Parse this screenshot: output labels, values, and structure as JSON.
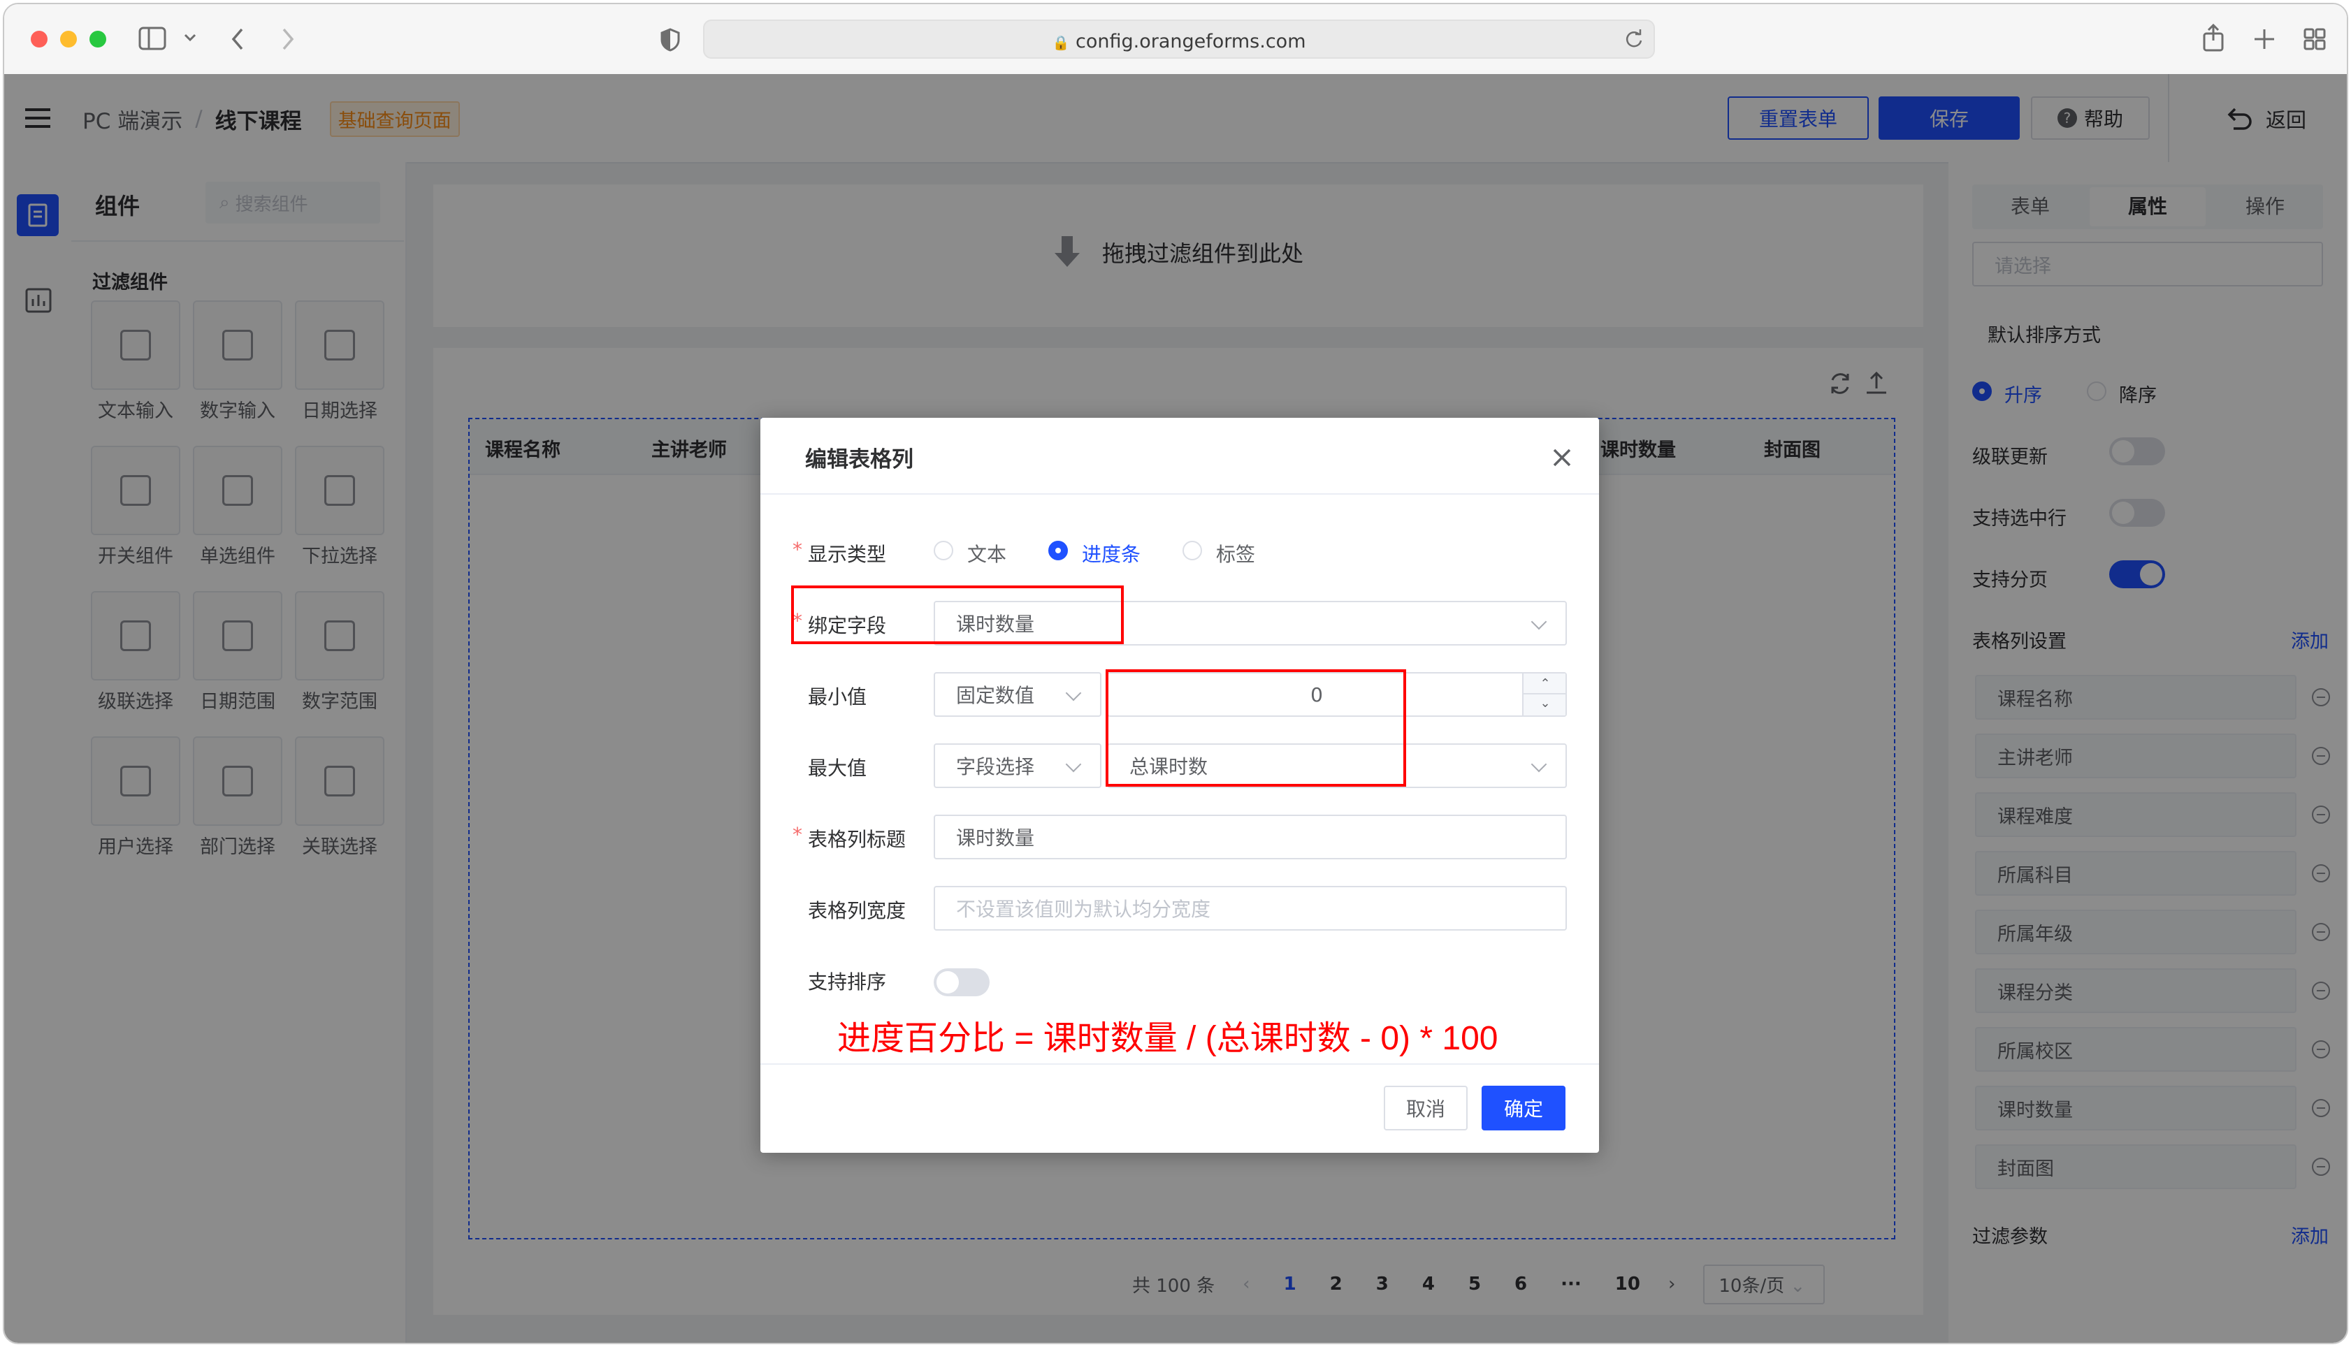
{
  "browser": {
    "url": "config.orangeforms.com"
  },
  "header": {
    "breadcrumb_root": "PC 端演示",
    "breadcrumb_sep": "/",
    "breadcrumb_current": "线下课程",
    "page_tag": "基础查询页面",
    "reset_label": "重置表单",
    "save_label": "保存",
    "help_label": "帮助",
    "back_label": "返回"
  },
  "left_panel": {
    "title": "组件",
    "search_placeholder": "搜索组件",
    "section_title": "过滤组件",
    "components": [
      {
        "label": "文本输入",
        "icon": "text-input-icon"
      },
      {
        "label": "数字输入",
        "icon": "number-input-icon"
      },
      {
        "label": "日期选择",
        "icon": "date-picker-icon"
      },
      {
        "label": "开关组件",
        "icon": "switch-icon"
      },
      {
        "label": "单选组件",
        "icon": "radio-icon"
      },
      {
        "label": "下拉选择",
        "icon": "dropdown-icon"
      },
      {
        "label": "级联选择",
        "icon": "cascader-icon"
      },
      {
        "label": "日期范围",
        "icon": "date-range-icon"
      },
      {
        "label": "数字范围",
        "icon": "number-range-icon"
      },
      {
        "label": "用户选择",
        "icon": "user-select-icon"
      },
      {
        "label": "部门选择",
        "icon": "dept-select-icon"
      },
      {
        "label": "关联选择",
        "icon": "relation-select-icon"
      }
    ]
  },
  "canvas": {
    "drop_hint": "拖拽过滤组件到此处",
    "table_headers": [
      "课程名称",
      "主讲老师",
      "课时数量",
      "封面图"
    ],
    "pagination": {
      "total": "共 100 条",
      "pages": [
        "1",
        "2",
        "3",
        "4",
        "5",
        "6",
        "···",
        "10"
      ],
      "current": "1",
      "page_size": "10条/页"
    }
  },
  "right_panel": {
    "tabs": [
      "表单",
      "属性",
      "操作"
    ],
    "active_tab": "属性",
    "select_placeholder": "请选择",
    "sort_label": "默认排序方式",
    "sort_asc": "升序",
    "sort_desc": "降序",
    "cascade_update": "级联更新",
    "support_select_row": "支持选中行",
    "support_paging": "支持分页",
    "column_settings": "表格列设置",
    "add_label": "添加",
    "columns": [
      "课程名称",
      "主讲老师",
      "课程难度",
      "所属科目",
      "所属年级",
      "课程分类",
      "所属校区",
      "课时数量",
      "封面图"
    ],
    "filter_params": "过滤参数",
    "add_label2": "添加"
  },
  "dialog": {
    "title": "编辑表格列",
    "display_type_label": "显示类型",
    "display_types": [
      "文本",
      "进度条",
      "标签"
    ],
    "display_type_selected": "进度条",
    "bind_field_label": "绑定字段",
    "bind_field_value": "课时数量",
    "min_label": "最小值",
    "min_mode": "固定数值",
    "min_value": "0",
    "max_label": "最大值",
    "max_mode": "字段选择",
    "max_value": "总课时数",
    "col_title_label": "表格列标题",
    "col_title_value": "课时数量",
    "col_width_label": "表格列宽度",
    "col_width_placeholder": "不设置该值则为默认均分宽度",
    "sortable_label": "支持排序",
    "formula": "进度百分比 = 课时数量 / (总课时数 - 0) * 100",
    "cancel_label": "取消",
    "confirm_label": "确定"
  },
  "colors": {
    "primary": "#1f51ff",
    "annotation_red": "#ff0000",
    "tag_orange": "#fa8c16"
  }
}
